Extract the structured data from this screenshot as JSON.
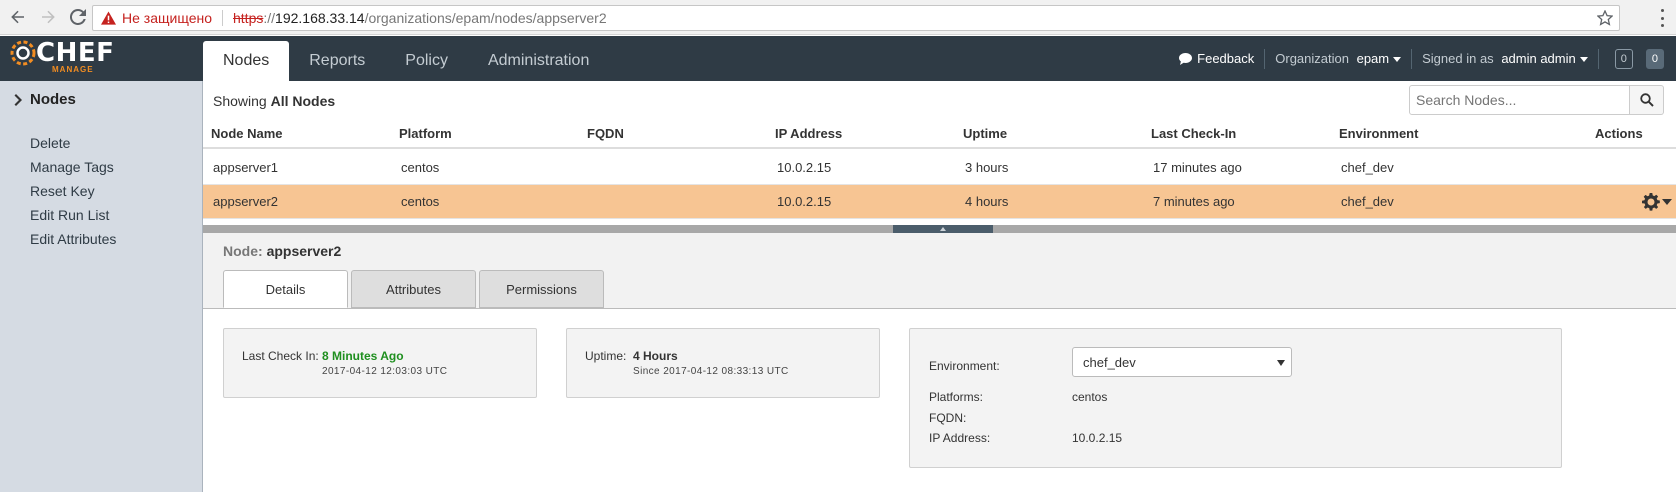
{
  "browser": {
    "security_label": "Не защищено",
    "url_scheme": "https",
    "url_sep": "://",
    "url_host": "192.168.33.14",
    "url_path": "/organizations/epam/nodes/appserver2"
  },
  "app": {
    "logo_text": "CHEF",
    "logo_sub": "MANAGE",
    "tabs": [
      {
        "label": "Nodes",
        "active": true
      },
      {
        "label": "Reports",
        "active": false
      },
      {
        "label": "Policy",
        "active": false
      },
      {
        "label": "Administration",
        "active": false
      }
    ],
    "feedback_label": "Feedback",
    "org_label": "Organization",
    "org_value": "epam",
    "signed_in_label": "Signed in as",
    "user_value": "admin admin",
    "badge_1": "0",
    "badge_2": "0"
  },
  "sidebar": {
    "heading": "Nodes",
    "links": [
      "Delete",
      "Manage Tags",
      "Reset Key",
      "Edit Run List",
      "Edit Attributes"
    ]
  },
  "nodes": {
    "showing_prefix": "Showing",
    "showing_value": "All Nodes",
    "search_placeholder": "Search Nodes...",
    "columns": [
      "Node Name",
      "Platform",
      "FQDN",
      "IP Address",
      "Uptime",
      "Last Check-In",
      "Environment",
      "Actions"
    ],
    "rows": [
      {
        "name": "appserver1",
        "platform": "centos",
        "fqdn": "",
        "ip": "10.0.2.15",
        "uptime": "3 hours",
        "checkin": "17 minutes ago",
        "env": "chef_dev",
        "selected": false
      },
      {
        "name": "appserver2",
        "platform": "centos",
        "fqdn": "",
        "ip": "10.0.2.15",
        "uptime": "4 hours",
        "checkin": "7 minutes ago",
        "env": "chef_dev",
        "selected": true
      }
    ]
  },
  "detail": {
    "node_label": "Node:",
    "node_name": "appserver2",
    "tabs": [
      "Details",
      "Attributes",
      "Permissions"
    ],
    "last_check_in_label": "Last Check In:",
    "last_check_in_value": "8 Minutes Ago",
    "last_check_in_ts": "2017-04-12 12:03:03 UTC",
    "uptime_label": "Uptime:",
    "uptime_value": "4 Hours",
    "uptime_since": "Since 2017-04-12 08:33:13 UTC",
    "environment_label": "Environment:",
    "environment_value": "chef_dev",
    "platforms_label": "Platforms:",
    "platforms_value": "centos",
    "fqdn_label": "FQDN:",
    "fqdn_value": "",
    "ip_label": "IP Address:",
    "ip_value": "10.0.2.15"
  },
  "colors": {
    "topbar": "#2f3b45",
    "sidebar": "#d5dbe3",
    "selected_row": "#f7c593",
    "brand_orange": "#f28d22",
    "ok_green": "#1e8f1e"
  },
  "icons": [
    "back-arrow-icon",
    "forward-arrow-icon",
    "reload-icon",
    "warning-icon",
    "star-icon",
    "menu-dots-icon",
    "chef-logo-icon",
    "chat-bubble-icon",
    "chevron-right-icon",
    "search-icon",
    "gear-icon"
  ]
}
